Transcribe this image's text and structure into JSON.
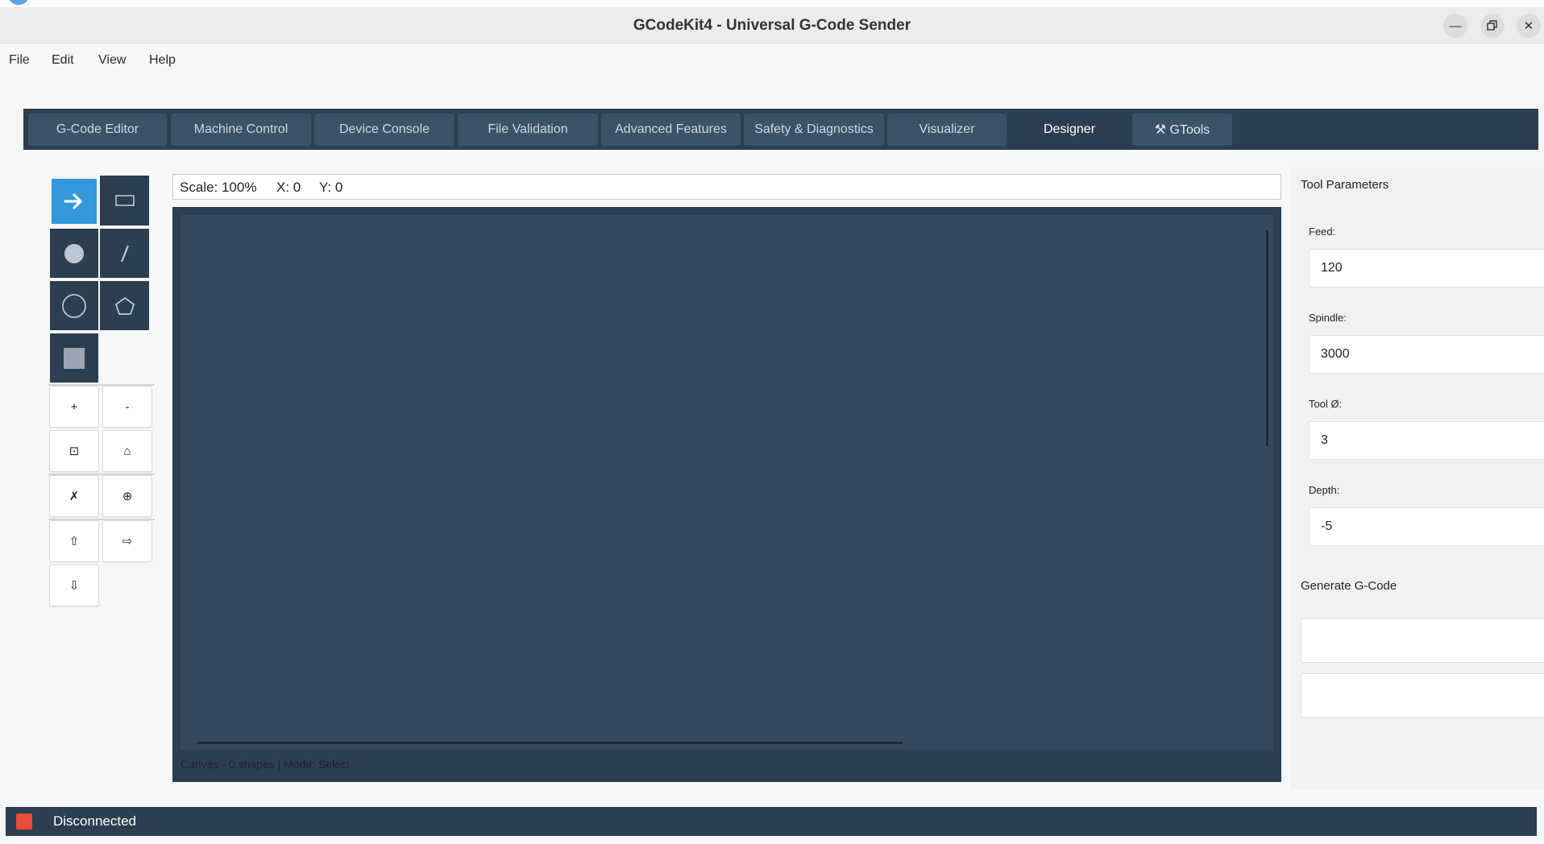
{
  "window": {
    "title": "GCodeKit4 - Universal G-Code Sender",
    "minimize_icon": "minimize-icon",
    "maximize_icon": "restore-icon",
    "close_icon": "close-icon"
  },
  "menu": [
    "File",
    "Edit",
    "View",
    "Help"
  ],
  "tabs": [
    {
      "label": "G-Code Editor"
    },
    {
      "label": "Machine Control"
    },
    {
      "label": "Device Console"
    },
    {
      "label": "File Validation"
    },
    {
      "label": "Advanced Features"
    },
    {
      "label": "Safety & Diagnostics"
    },
    {
      "label": "Visualizer"
    },
    {
      "label": "Designer",
      "active": true
    },
    {
      "label": "⚒ GTools"
    }
  ],
  "tools": {
    "shape_tools": [
      {
        "name": "select-tool",
        "icon": "arrow-right-icon",
        "selected": true
      },
      {
        "name": "rectangle-tool",
        "icon": "rectangle-icon"
      },
      {
        "name": "filled-circle-tool",
        "icon": "filled-circle-icon"
      },
      {
        "name": "line-tool",
        "icon": "line-icon"
      },
      {
        "name": "circle-tool",
        "icon": "circle-outline-icon"
      },
      {
        "name": "polygon-tool",
        "icon": "pentagon-icon"
      },
      {
        "name": "filled-rectangle-tool",
        "icon": "filled-square-icon"
      }
    ],
    "view_buttons": {
      "zoom_in": "+",
      "zoom_out": "-",
      "fit": "⊡",
      "home": "⌂",
      "delete": "✗",
      "center": "⊕",
      "move_up": "⇧",
      "move_right": "⇨",
      "move_down": "⇩"
    }
  },
  "coord_bar": {
    "scale": "Scale: 100%",
    "x": "X: 0",
    "y": "Y: 0"
  },
  "canvas": {
    "status": "Canvas - 0 shapes | Mode: Select"
  },
  "tool_parameters": {
    "title": "Tool Parameters",
    "feed_label": "Feed:",
    "feed_value": "120",
    "spindle_label": "Spindle:",
    "spindle_value": "3000",
    "tool_dia_label": "Tool Ø:",
    "tool_dia_value": "3",
    "depth_label": "Depth:",
    "depth_value": "-5"
  },
  "generate": {
    "title": "Generate G-Code"
  },
  "status": {
    "text": "Disconnected",
    "color": "#e74c3c"
  },
  "colors": {
    "accent": "#3498db",
    "dark_panel": "#2c3e50",
    "canvas": "#34495e"
  }
}
